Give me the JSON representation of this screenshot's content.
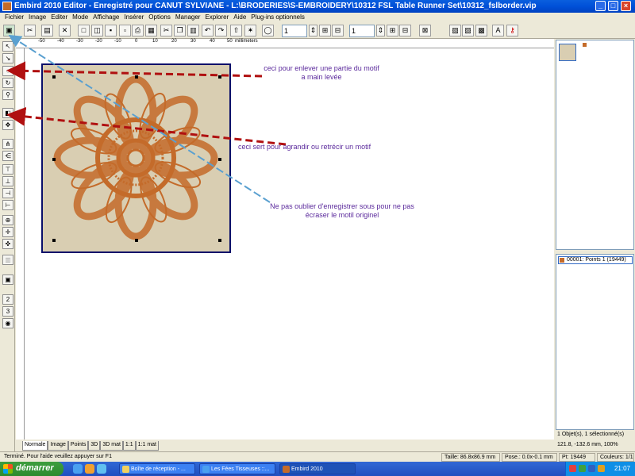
{
  "window": {
    "title": "Embird 2010 Editor - Enregistré pour CANUT SYLVIANE - L:\\BRODERIES\\S-EMBROIDERY\\10312 FSL Table Runner Set\\10312_fslborder.vip"
  },
  "menu": [
    "Fichier",
    "Image",
    "Editer",
    "Mode",
    "Affichage",
    "Insérer",
    "Options",
    "Manager",
    "Explorer",
    "Aide",
    "Plug-ins optionnels"
  ],
  "toolbar": {
    "spin1": "1",
    "spin2": "1"
  },
  "ruler": {
    "unit": "millimeters",
    "ticks": [
      "-50",
      "-40",
      "-30",
      "-20",
      "-10",
      "0",
      "10",
      "20",
      "30",
      "40",
      "50"
    ]
  },
  "annotations": {
    "a1": "ceci pour enlever une partie du motif a main levée",
    "a2": "ceci sert pour agrandir ou retrécir un motif",
    "a3": "Ne pas oublier d'enregistrer sous pour ne pas écraser le motil originel"
  },
  "objects": {
    "item": "00001: Points 1 (19449)",
    "status": "1 Objet(s), 1 sélectionné(s)",
    "coords": "121.8, -132.6 mm, 100%"
  },
  "tabs": [
    "Normale",
    "Image",
    "Points",
    "3D",
    "3D mat",
    "1:1",
    "1:1 mat"
  ],
  "status": {
    "help": "Terminé. Pour l'aide veuillez appuyer sur F1",
    "size": "Taille: 86.8x86.9 mm",
    "pos": "Pose.: 0.0x-0.1 mm",
    "pt": "Pt: 19449",
    "colors": "Couleurs: 1/1"
  },
  "taskbar": {
    "start": "démarrer",
    "tasks": [
      "Boîte de réception - ...",
      "Les Fées Tisseuses ::...",
      "Embird 2010"
    ],
    "clock": "21:07"
  },
  "colors": {
    "thread": "#c46b2a",
    "hoop_bg": "#d9ceb2",
    "note": "#5b2a9c",
    "arrow_red": "#b01010",
    "arrow_blue": "#5aa0d0"
  }
}
